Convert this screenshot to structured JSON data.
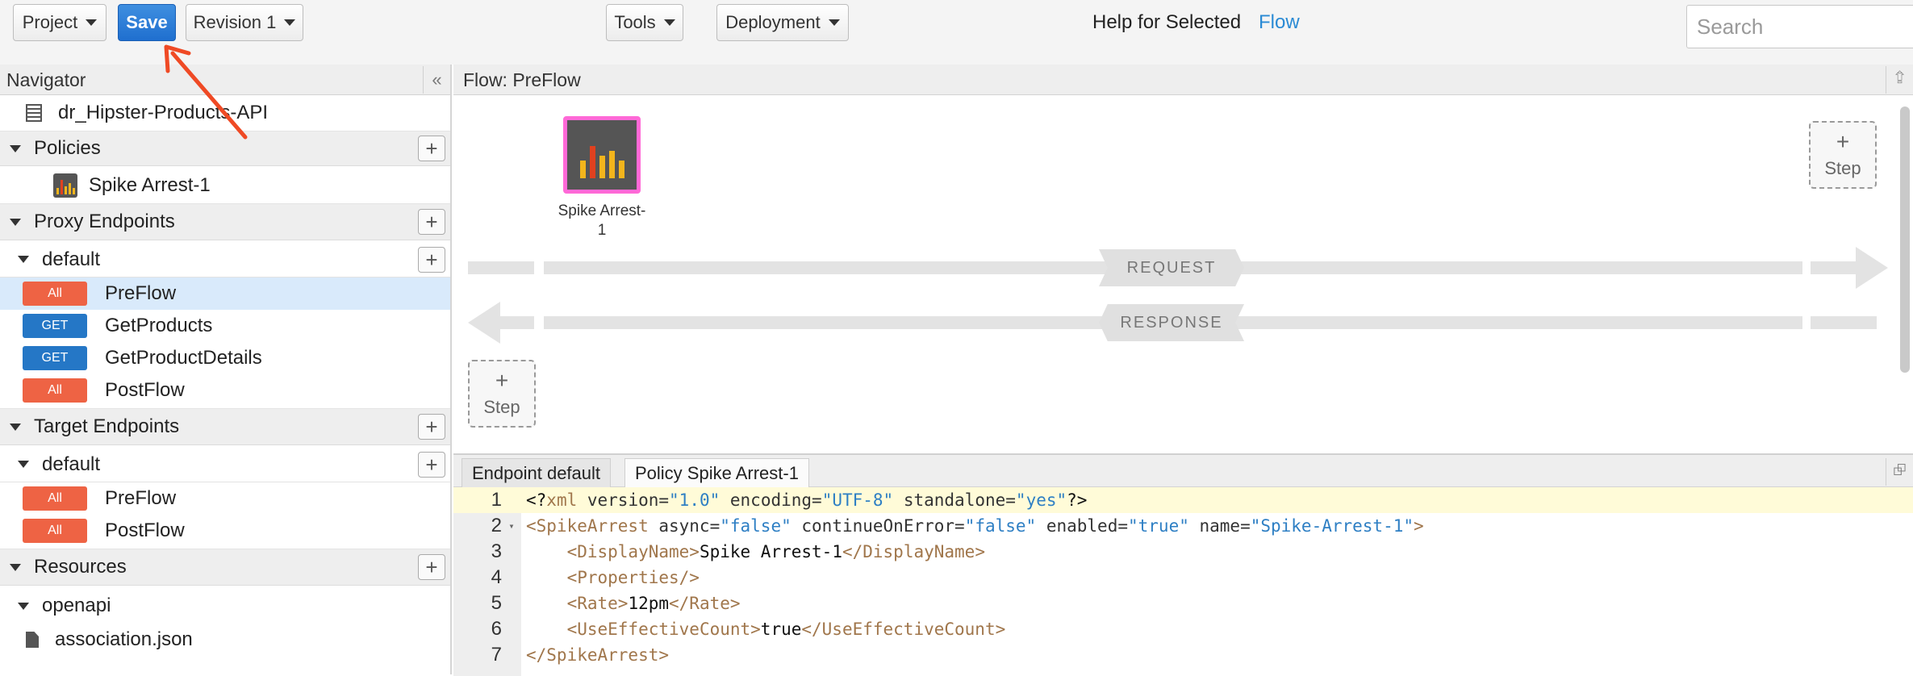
{
  "toolbar": {
    "project_label": "Project",
    "save_label": "Save",
    "revision_label": "Revision 1",
    "tools_label": "Tools",
    "deployment_label": "Deployment",
    "help_text": "Help for Selected",
    "help_link": "Flow",
    "search_placeholder": "Search"
  },
  "navigator": {
    "title": "Navigator",
    "collapse_glyph": "«",
    "proxy_name": "dr_Hipster-Products-API",
    "sections": {
      "policies": "Policies",
      "proxy_endpoints": "Proxy Endpoints",
      "target_endpoints": "Target Endpoints",
      "resources": "Resources"
    },
    "policy_item": "Spike Arrest-1",
    "proxy_default": "default",
    "proxy_flows": [
      {
        "verb": "All",
        "name": "PreFlow"
      },
      {
        "verb": "GET",
        "name": "GetProducts"
      },
      {
        "verb": "GET",
        "name": "GetProductDetails"
      },
      {
        "verb": "All",
        "name": "PostFlow"
      }
    ],
    "target_default": "default",
    "target_flows": [
      {
        "verb": "All",
        "name": "PreFlow"
      },
      {
        "verb": "All",
        "name": "PostFlow"
      }
    ],
    "resource_folder": "openapi",
    "resource_file": "association.json"
  },
  "flow": {
    "title": "Flow: PreFlow",
    "policy_label": "Spike Arrest-1",
    "request_label": "REQUEST",
    "response_label": "RESPONSE",
    "step_label": "Step",
    "step_plus": "+"
  },
  "editor": {
    "tabs": [
      "Endpoint default",
      "Policy Spike Arrest-1"
    ],
    "lines": [
      {
        "n": "1",
        "parts": [
          [
            "t-txt",
            "<?"
          ],
          [
            "t-tag",
            "xml"
          ],
          [
            "t-attr",
            " version="
          ],
          [
            "t-val",
            "\"1.0\""
          ],
          [
            "t-attr",
            " encoding="
          ],
          [
            "t-val",
            "\"UTF-8\""
          ],
          [
            "t-attr",
            " standalone="
          ],
          [
            "t-val",
            "\"yes\""
          ],
          [
            "t-txt",
            "?>"
          ]
        ]
      },
      {
        "n": "2",
        "parts": [
          [
            "t-tag",
            "<SpikeArrest"
          ],
          [
            "t-attr",
            " async="
          ],
          [
            "t-val",
            "\"false\""
          ],
          [
            "t-attr",
            " continueOnError="
          ],
          [
            "t-val",
            "\"false\""
          ],
          [
            "t-attr",
            " enabled="
          ],
          [
            "t-val",
            "\"true\""
          ],
          [
            "t-attr",
            " name="
          ],
          [
            "t-val",
            "\"Spike-Arrest-1\""
          ],
          [
            "t-tag",
            ">"
          ]
        ]
      },
      {
        "n": "3",
        "parts": [
          [
            "t-txt",
            "    "
          ],
          [
            "t-tag",
            "<DisplayName>"
          ],
          [
            "t-txt",
            "Spike Arrest-1"
          ],
          [
            "t-tag",
            "</DisplayName>"
          ]
        ]
      },
      {
        "n": "4",
        "parts": [
          [
            "t-txt",
            "    "
          ],
          [
            "t-tag",
            "<Properties/>"
          ]
        ]
      },
      {
        "n": "5",
        "parts": [
          [
            "t-txt",
            "    "
          ],
          [
            "t-tag",
            "<Rate>"
          ],
          [
            "t-txt",
            "12pm"
          ],
          [
            "t-tag",
            "</Rate>"
          ]
        ]
      },
      {
        "n": "6",
        "parts": [
          [
            "t-txt",
            "    "
          ],
          [
            "t-tag",
            "<UseEffectiveCount>"
          ],
          [
            "t-txt",
            "true"
          ],
          [
            "t-tag",
            "</UseEffectiveCount>"
          ]
        ]
      },
      {
        "n": "7",
        "parts": [
          [
            "t-tag",
            "</SpikeArrest>"
          ]
        ]
      }
    ]
  },
  "colors": {
    "accent_blue": "#2577c6",
    "verb_all": "#ee6344",
    "selected_row": "#d9eafb",
    "annotation_arrow": "#ef4a25",
    "policy_border": "#ff69d7"
  }
}
